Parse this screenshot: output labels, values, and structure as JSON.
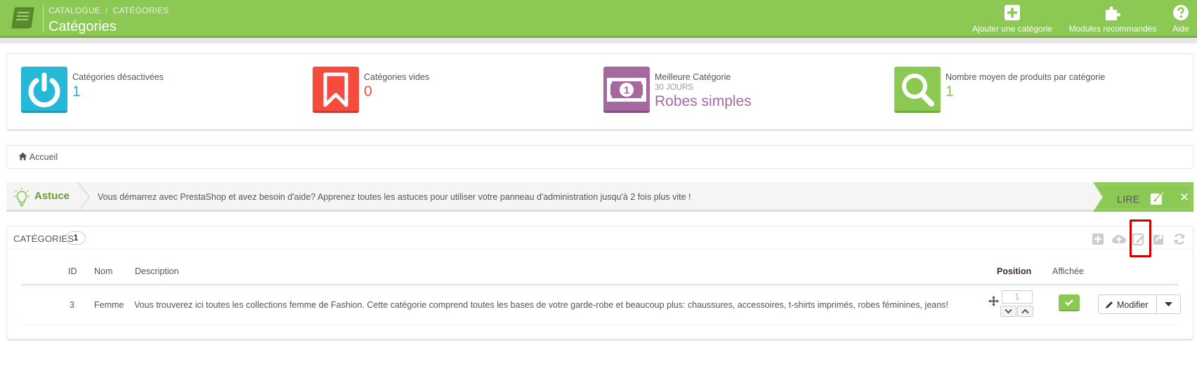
{
  "header": {
    "breadcrumb": [
      "CATALOGUE",
      "CATÉGORIES"
    ],
    "separator": "/",
    "title": "Catégories",
    "toolbar": [
      {
        "label": "Ajouter une catégorie",
        "icon": "plus-square-icon"
      },
      {
        "label": "Modules recommandés",
        "icon": "puzzle-icon"
      },
      {
        "label": "Aide",
        "icon": "help-circle-icon"
      }
    ],
    "colors": {
      "accent": "#8bc954"
    }
  },
  "kpis": [
    {
      "label": "Catégories désactivées",
      "value": "1",
      "color": "#25b9d7",
      "icon": "power-icon"
    },
    {
      "label": "Catégories vides",
      "value": "0",
      "color": "#f54c3e",
      "icon": "bookmark-icon"
    },
    {
      "label": "Meilleure Catégorie",
      "sub": "30 JOURS",
      "value": "Robes simples",
      "color": "#a569a0",
      "icon": "money-icon"
    },
    {
      "label": "Nombre moyen de produits par catégorie",
      "value": "1",
      "color": "#8bc954",
      "icon": "search-icon"
    }
  ],
  "breadcrumb": {
    "home": "Accueil"
  },
  "tip": {
    "title": "Astuce",
    "message": "Vous démarrez avec PrestaShop et avez besoin d'aide? Apprenez toutes les astuces pour utiliser votre panneau d'administration jusqu'à 2 fois plus vite !",
    "read_label": "LIRE",
    "close": "✕"
  },
  "panel": {
    "title": "CATÉGORIES",
    "count": "1",
    "columns": {
      "id": "ID",
      "name": "Nom",
      "description": "Description",
      "position": "Position",
      "displayed": "Affichée"
    },
    "rows": [
      {
        "id": "3",
        "name": "Femme",
        "description": "Vous trouverez ici toutes les collections femme de Fashion. Cette catégorie comprend toutes les bases de votre garde-robe et beaucoup plus: chaussures, accessoires, t-shirts imprimés, robes féminines, jeans!",
        "position": "1",
        "edit_label": "Modifier"
      }
    ]
  }
}
